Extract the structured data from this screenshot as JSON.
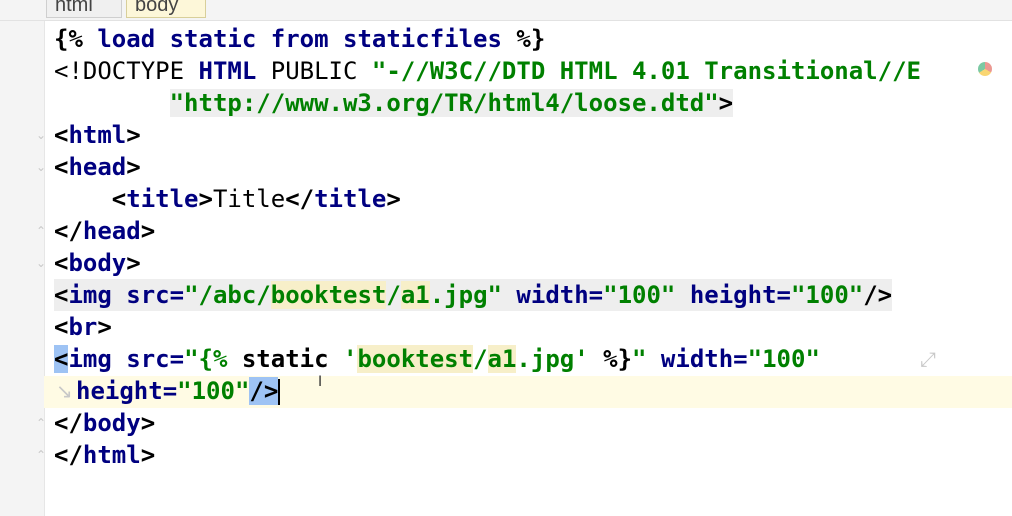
{
  "breadcrumbs": [
    "html",
    "body"
  ],
  "code": {
    "l1": {
      "a": "{% ",
      "b": "load static from staticfiles",
      "c": " %}"
    },
    "l2": {
      "a": "<!DOCTYPE ",
      "b": "HTML",
      "c": " PUBLIC ",
      "d": "\"-//W3C//DTD HTML 4.01 Transitional//E"
    },
    "l3": {
      "a": "        ",
      "b": "\"http://www.w3.org/TR/html4/loose.dtd\"",
      "c": ">"
    },
    "l4": {
      "a": "<",
      "b": "html",
      "c": ">"
    },
    "l5": {
      "a": "<",
      "b": "head",
      "c": ">"
    },
    "l6": {
      "a": "    <",
      "b": "title",
      "c": ">",
      "d": "Title",
      "e": "</",
      "f": "title",
      "g": ">"
    },
    "l7": {
      "a": "</",
      "b": "head",
      "c": ">"
    },
    "l8": {
      "a": "<",
      "b": "body",
      "c": ">"
    },
    "l9": {
      "a": "<",
      "b": "img",
      "c": " src=",
      "d": "\"/abc/",
      "e": "booktest",
      "f": "/",
      "g": "a1",
      "h": ".jpg\"",
      "i": " width=",
      "j": "\"100\"",
      "k": " height=",
      "l": "\"100\"",
      "m": "/>"
    },
    "l10": {
      "a": "<",
      "b": "br",
      "c": ">"
    },
    "l11": {
      "a": "<",
      "b": "img",
      "c": " src=",
      "d": "\"{% ",
      "e": "static ",
      "f": "'",
      "g": "booktest",
      "h": "/",
      "i": "a1",
      "j": ".jpg",
      "k": "'",
      "l": " %}",
      "m": "\"",
      "n": " width=",
      "o": "\"100\""
    },
    "l12": {
      "a": "height=",
      "b": "\"100\"",
      "c": "/>"
    },
    "l13": {
      "a": "</",
      "b": "body",
      "c": ">"
    },
    "l14": {
      "a": "</",
      "b": "html",
      "c": ">"
    }
  },
  "icons": {
    "wrap": "soft-wrap-icon",
    "mouse": "mouse-cursor-icon",
    "browser": "chrome-icon"
  },
  "colors": {
    "tag": "#000080",
    "string": "#008000",
    "selection": "#9ec3f4",
    "current_line": "#fffbe4"
  }
}
